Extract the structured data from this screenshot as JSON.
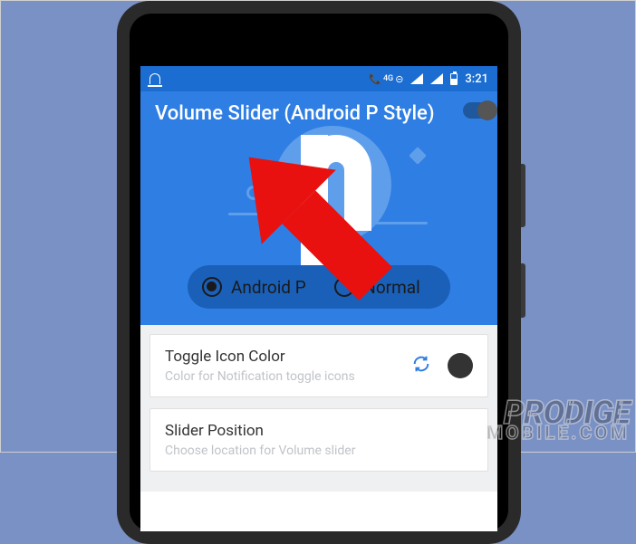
{
  "statusbar": {
    "network_label": "4G",
    "time": "3:21"
  },
  "header": {
    "title": "Volume Slider (Android P Style)",
    "mode_options": {
      "android_p": "Android P",
      "normal": "Normal"
    }
  },
  "settings": {
    "toggle_icon_color": {
      "title": "Toggle Icon Color",
      "subtitle": "Color for Notification toggle icons"
    },
    "slider_position": {
      "title": "Slider Position",
      "subtitle": "Choose location for Volume slider"
    }
  },
  "watermark": {
    "line1": "PRODIGE",
    "line2": "MOBILE.COM"
  }
}
